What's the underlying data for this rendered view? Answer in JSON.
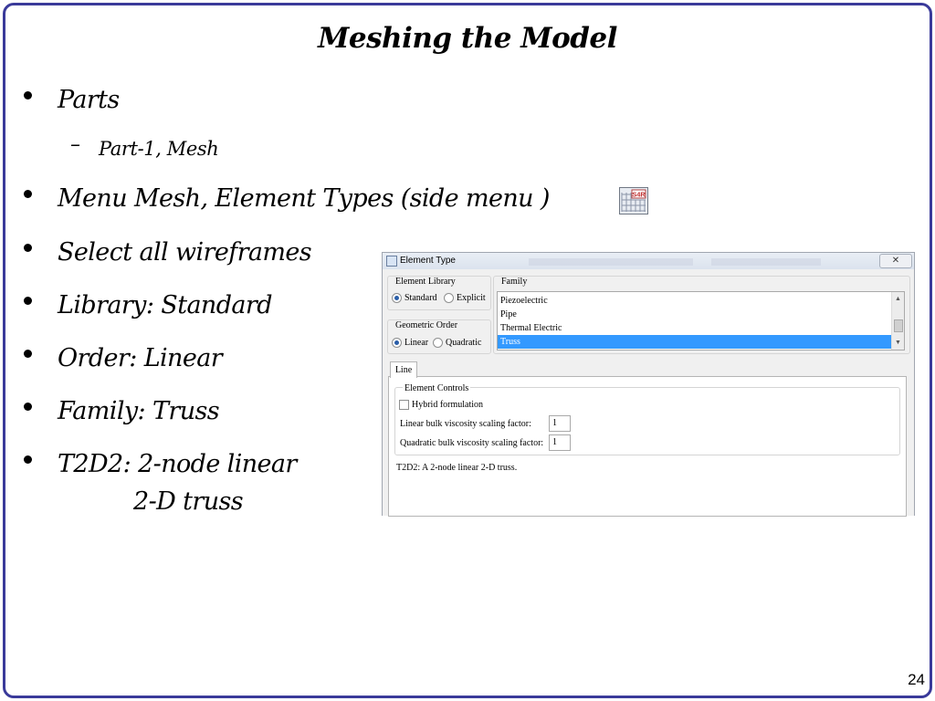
{
  "slide": {
    "title": "Meshing the Model",
    "page_number": "24",
    "bullets": [
      {
        "text": "Parts"
      },
      {
        "text": "Menu Mesh, Element Types (side menu    )"
      },
      {
        "text": "Select all wireframes"
      },
      {
        "text": "Library: Standard"
      },
      {
        "text": "Order: Linear"
      },
      {
        "text": "Family: Truss"
      },
      {
        "text": "T2D2: 2-node linear"
      }
    ],
    "sub_bullet": {
      "dash": "–",
      "text": "Part-1, Mesh"
    },
    "bullet_cont": "2-D truss",
    "icon_label": "S4R"
  },
  "dialog": {
    "title": "Element Type",
    "close_label": "✕",
    "element_library": {
      "label": "Element Library",
      "options": [
        "Standard",
        "Explicit"
      ],
      "selected": "Standard"
    },
    "geometric_order": {
      "label": "Geometric Order",
      "options": [
        "Linear",
        "Quadratic"
      ],
      "selected": "Linear"
    },
    "family": {
      "label": "Family",
      "items": [
        "Piezoelectric",
        "Pipe",
        "Thermal Electric",
        "Truss"
      ],
      "selected": "Truss"
    },
    "tab_label": "Line",
    "element_controls": {
      "label": "Element Controls",
      "hybrid_label": "Hybrid formulation",
      "linear_label": "Linear bulk viscosity scaling factor:",
      "linear_value": "1",
      "quadratic_label": "Quadratic bulk viscosity scaling factor:",
      "quadratic_value": "1"
    },
    "description": "T2D2:  A 2-node linear 2-D truss."
  },
  "colors": {
    "frame": "#3a3a9a",
    "selection": "#3399ff"
  }
}
